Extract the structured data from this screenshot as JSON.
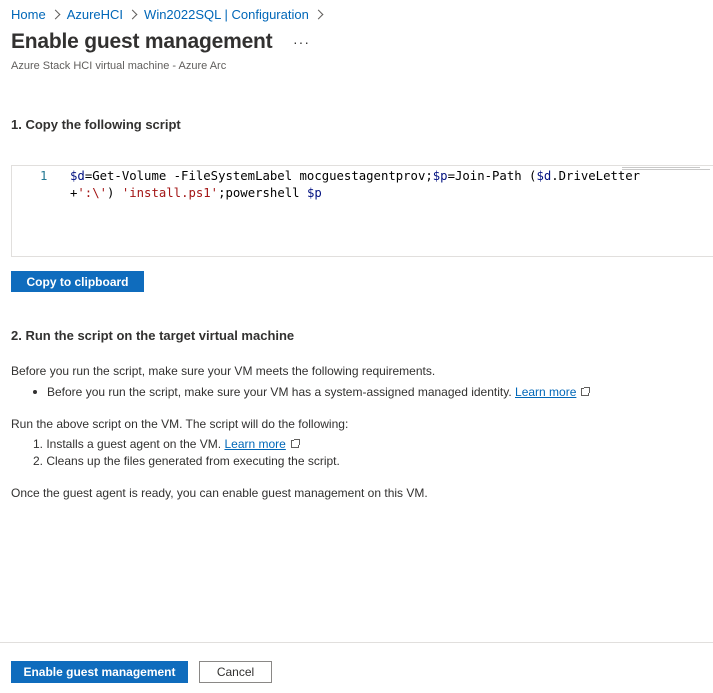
{
  "breadcrumb": [
    "Home",
    "AzureHCI",
    "Win2022SQL | Configuration"
  ],
  "page": {
    "title": "Enable guest management",
    "more": "···",
    "subtitle": "Azure Stack HCI virtual machine - Azure Arc"
  },
  "step1": {
    "heading": "1. Copy the following script",
    "line_number": "1",
    "code_line1": {
      "a": "$d",
      "b": "=Get-Volume -FileSystemLabel mocguestagentprov;",
      "c": "$p",
      "d": "=Join-Path (",
      "e": "$d",
      "f": ".DriveLetter"
    },
    "code_line2": {
      "a": "+",
      "b": "':\\'",
      "c": ") ",
      "d": "'install.ps1'",
      "e": ";powershell ",
      "f": "$p"
    },
    "copy_button": "Copy to clipboard"
  },
  "step2": {
    "heading": "2. Run the script on the target virtual machine",
    "req_intro": "Before you run the script, make sure your VM meets the following requirements.",
    "req_bullet": "Before you run the script, make sure your VM has a system-assigned managed identity.",
    "learn_more": "Learn more",
    "run_intro": "Run the above script on the VM. The script will do the following:",
    "item1": "1. Installs a guest agent on the VM.",
    "item2": "2. Cleans up the files generated from executing the script.",
    "outro": "Once the guest agent is ready, you can enable guest management on this VM."
  },
  "footer": {
    "enable_button": "Enable guest management",
    "cancel_button": "Cancel"
  },
  "colors": {
    "accent": "#0f6cbd",
    "link": "#0067b8",
    "text": "#323130"
  }
}
